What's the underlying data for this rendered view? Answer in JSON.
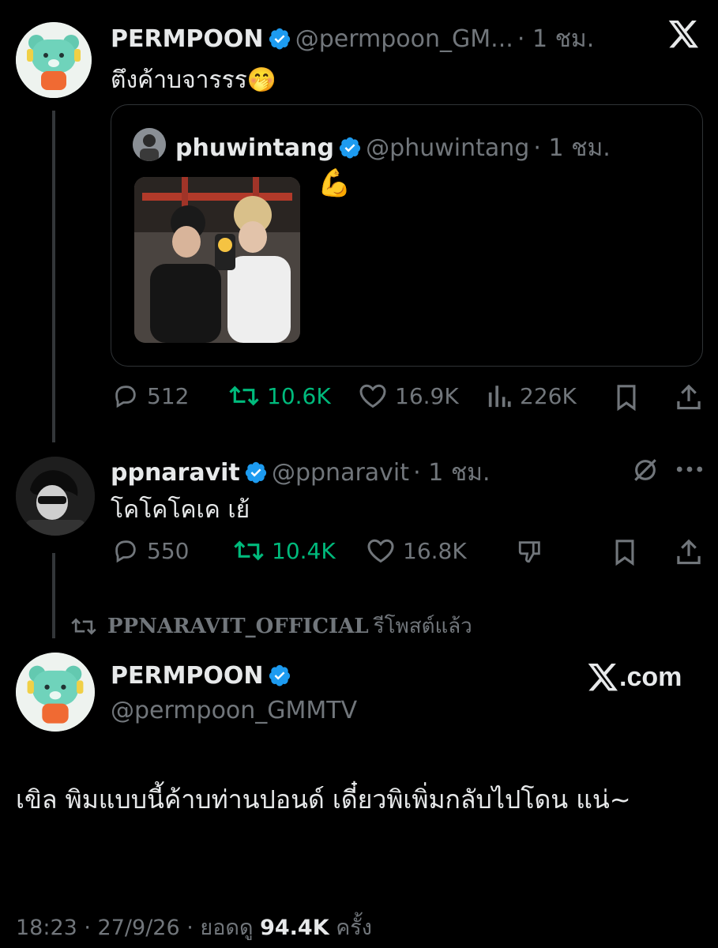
{
  "tweet1": {
    "name": "PERMPOON",
    "handle": "@permpoon_GM...",
    "time": "· 1 ชม.",
    "text": "ตึงค้าบจารรร🤭",
    "quote": {
      "name": "phuwintang",
      "handle": "@phuwintang",
      "time": "· 1 ชม.",
      "text": "💪"
    },
    "actions": {
      "replies": "512",
      "reposts": "10.6K",
      "likes": "16.9K",
      "views": "226K"
    }
  },
  "tweet2": {
    "name": "ppnaravit",
    "handle": "@ppnaravit",
    "time": "· 1 ชม.",
    "text": "โคโคโคเค เย้",
    "actions": {
      "replies": "550",
      "reposts": "10.4K",
      "likes": "16.8K"
    }
  },
  "repost_banner": {
    "user": "PPNARAVIT_OFFICIAL",
    "label": "รีโพสต์แล้ว"
  },
  "main_tweet": {
    "name": "PERMPOON",
    "handle": "@permpoon_GMMTV",
    "site": ".com",
    "text": "เขิล พิมแบบนี้ค้าบท่านปอนด์ เดี๋ยวพิเพิ่มกลับไปโดน แน่~",
    "time": "18:23 · 27/9/26 · ยอดดู",
    "views": "94.4K",
    "views_suffix": "ครั้ง"
  },
  "icons": [
    "x-logo",
    "verified-badge",
    "reply-icon",
    "repost-icon",
    "like-icon",
    "views-icon",
    "bookmark-icon",
    "share-icon",
    "grok-slash-icon",
    "more-icon",
    "dislike-icon"
  ],
  "colors": {
    "background": "#000000",
    "text": "#e7e9ea",
    "muted": "#71767b",
    "verified": "#1d9bf0",
    "repost_green": "#00ba7c"
  }
}
